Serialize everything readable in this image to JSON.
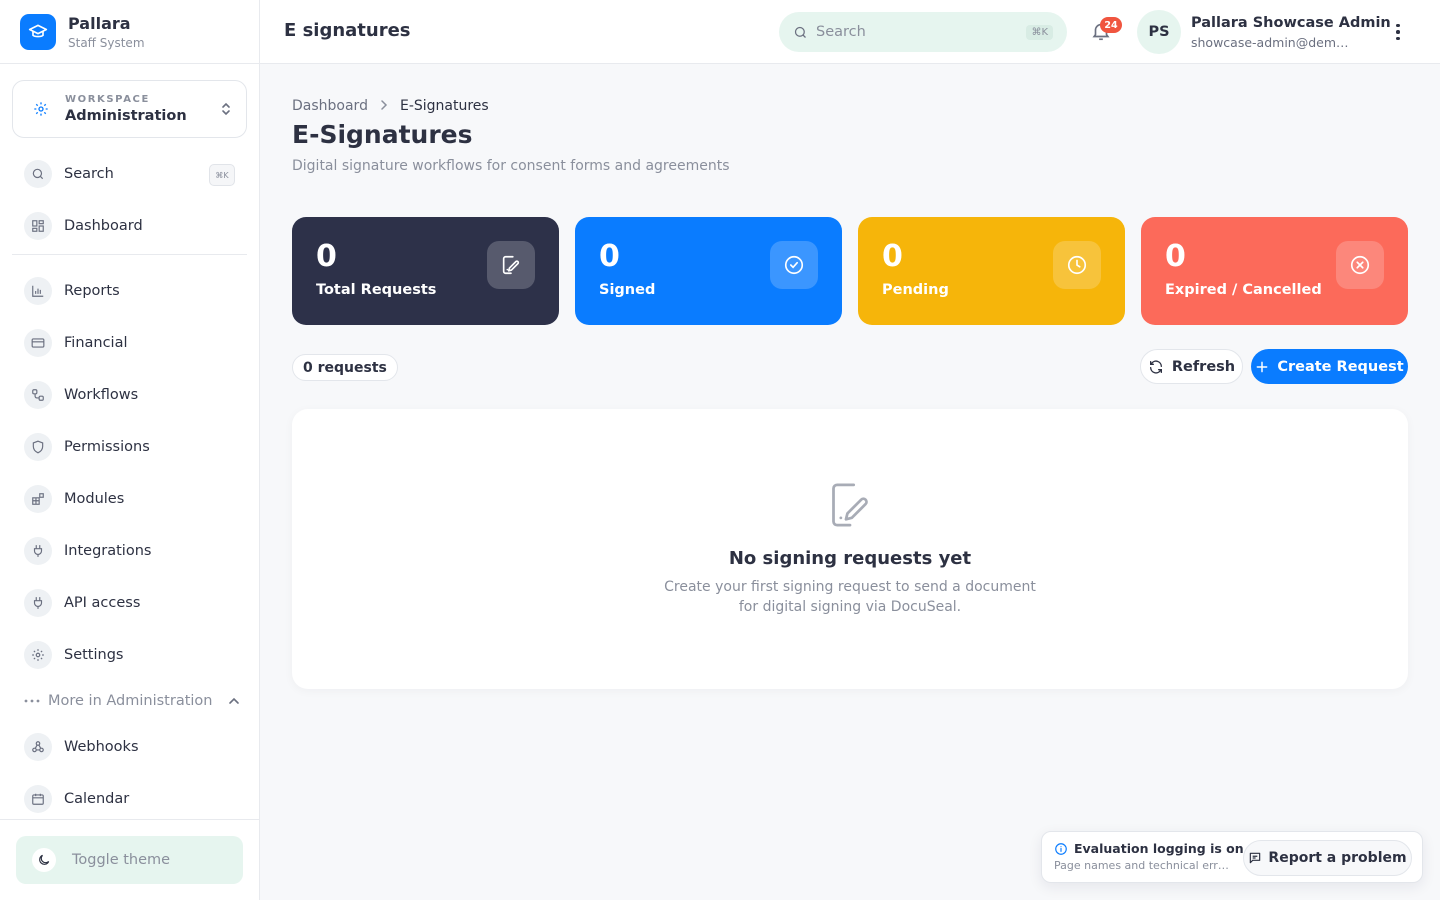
{
  "brand": {
    "name": "Pallara",
    "subtitle": "Staff System"
  },
  "workspace": {
    "label": "WORKSPACE",
    "name": "Administration"
  },
  "sidebar": {
    "search": {
      "label": "Search",
      "shortcut": "⌘K"
    },
    "items": [
      {
        "label": "Dashboard",
        "icon": "grid-icon"
      },
      {
        "label": "Reports",
        "icon": "bar-chart-icon"
      },
      {
        "label": "Financial",
        "icon": "credit-card-icon"
      },
      {
        "label": "Workflows",
        "icon": "workflow-icon"
      },
      {
        "label": "Permissions",
        "icon": "shield-icon"
      },
      {
        "label": "Modules",
        "icon": "modules-icon"
      },
      {
        "label": "Integrations",
        "icon": "plug-icon"
      },
      {
        "label": "API access",
        "icon": "plug-icon"
      },
      {
        "label": "Settings",
        "icon": "gear-icon"
      }
    ],
    "more_label": "More in Administration",
    "more_items": [
      {
        "label": "Webhooks",
        "icon": "webhook-icon"
      },
      {
        "label": "Calendar",
        "icon": "calendar-icon"
      }
    ],
    "toggle_theme": "Toggle theme"
  },
  "header": {
    "title": "E signatures",
    "search_placeholder": "Search",
    "search_shortcut": "⌘K",
    "notification_count": "24",
    "user": {
      "initials": "PS",
      "name": "Pallara Showcase Admin",
      "email": "showcase-admin@dem…"
    }
  },
  "breadcrumb": {
    "parent": "Dashboard",
    "current": "E-Signatures"
  },
  "page": {
    "title": "E-Signatures",
    "subtitle": "Digital signature workflows for consent forms and agreements"
  },
  "stats": [
    {
      "value": "0",
      "label": "Total Requests",
      "color": "#2d3149",
      "icon": "signature-icon"
    },
    {
      "value": "0",
      "label": "Signed",
      "color": "#0a7cff",
      "icon": "check-circle-icon"
    },
    {
      "value": "0",
      "label": "Pending",
      "color": "#f6b50a",
      "icon": "clock-icon"
    },
    {
      "value": "0",
      "label": "Expired / Cancelled",
      "color": "#fc6a5a",
      "icon": "x-circle-icon"
    }
  ],
  "toolbar": {
    "count_label": "0 requests",
    "refresh_label": "Refresh",
    "create_label": "Create Request"
  },
  "empty_state": {
    "title": "No signing requests yet",
    "line1": "Create your first signing request to send a document",
    "line2": "for digital signing via DocuSeal."
  },
  "toast": {
    "title": "Evaluation logging is on",
    "description": "Page names and technical err…",
    "button_label": "Report a problem"
  },
  "colors": {
    "accent": "#0a7cff",
    "mint": "#e6f5ef",
    "text": "#2d3142"
  }
}
